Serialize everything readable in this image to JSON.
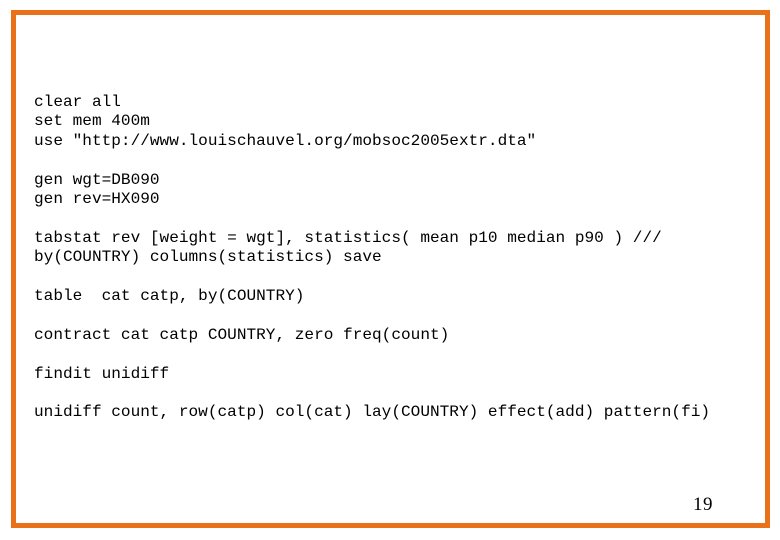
{
  "slide": {
    "page_number": "19",
    "border_color": "#e8711a",
    "background_color": "#ffffff",
    "text_color": "#000000"
  },
  "code": {
    "language": "stata",
    "lines": [
      "clear all",
      "set mem 400m",
      "use \"http://www.louischauvel.org/mobsoc2005extr.dta\"",
      "",
      "gen wgt=DB090",
      "gen rev=HX090",
      "",
      "tabstat rev [weight = wgt], statistics( mean p10 median p90 ) ///",
      "by(COUNTRY) columns(statistics) save",
      "",
      "table  cat catp, by(COUNTRY)",
      "",
      "contract cat catp COUNTRY, zero freq(count)",
      "",
      "findit unidiff",
      "",
      "unidiff count, row(catp) col(cat) lay(COUNTRY) effect(add) pattern(fi)"
    ]
  }
}
